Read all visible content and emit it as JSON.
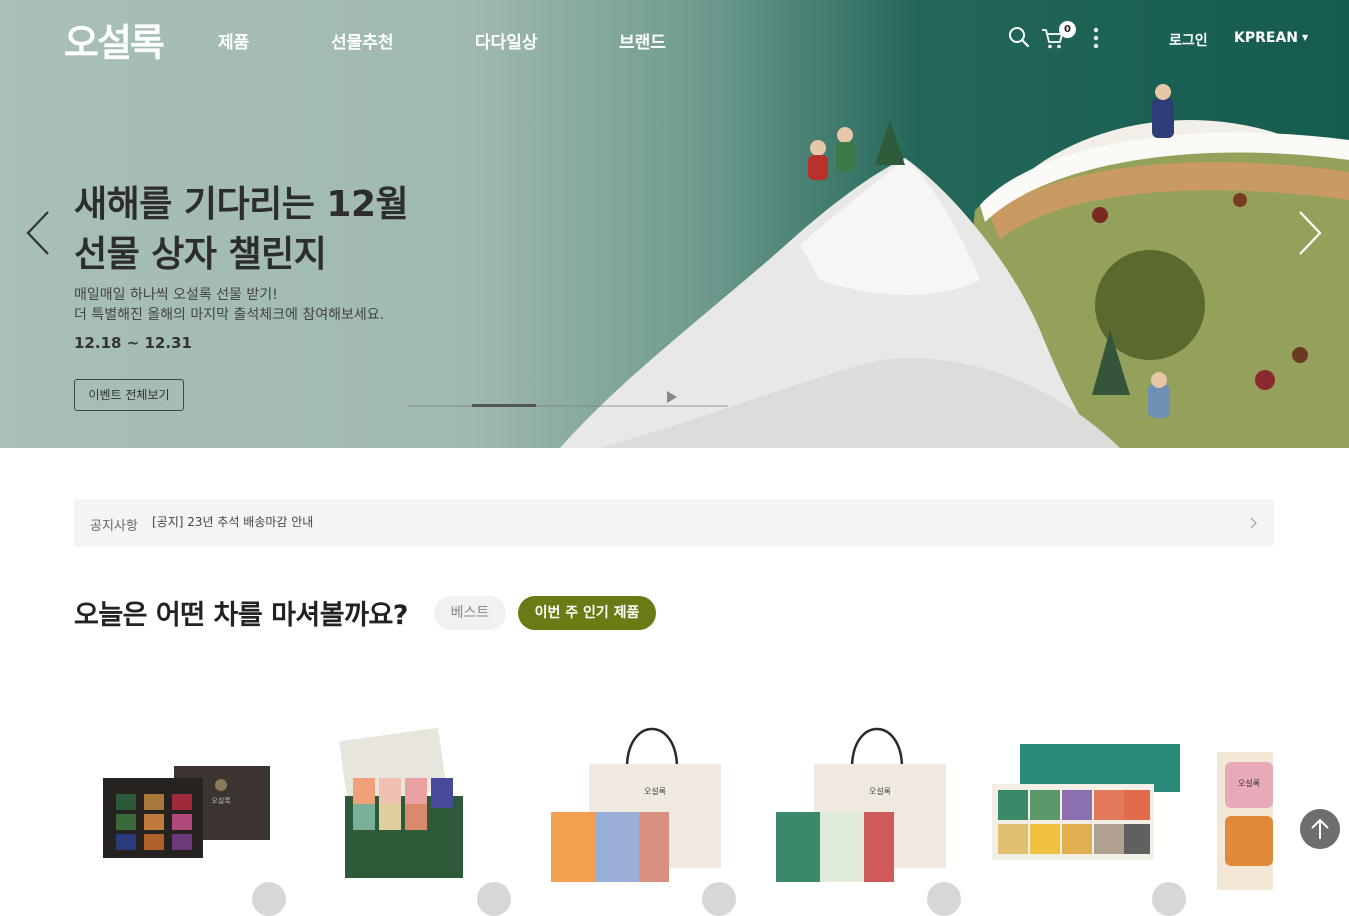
{
  "header": {
    "logo": "오설록",
    "nav": [
      "제품",
      "선물추천",
      "다다일상",
      "브랜드"
    ],
    "cart_count": "0",
    "login": "로그인",
    "language": "KPREAN"
  },
  "hero": {
    "title_line1": "새해를 기다리는 12월",
    "title_line2": "선물 상자 챌린지",
    "desc_line1": "매일매일 하나씩 오설록 선물 받기!",
    "desc_line2": "더 특별해진 올해의 마지막 출석체크에 참여해보세요.",
    "date": "12.18 ~ 12.31",
    "button": "이벤트 전체보기",
    "progress": 0.2
  },
  "notice": {
    "label": "공지사항",
    "text": "[공지] 23년 추석 배송마감 안내"
  },
  "section": {
    "title": "오늘은 어떤 차를 마셔볼까요?",
    "tabs": [
      {
        "label": "베스트",
        "active": false
      },
      {
        "label": "이번 주 인기 제품",
        "active": true
      }
    ]
  },
  "products": [
    {
      "icon": "dark-tea-gift-box-image",
      "box_label": "오설록"
    },
    {
      "icon": "green-tea-collection-box-image"
    },
    {
      "icon": "orange-tea-gift-bag-image",
      "bag_label": "오설록"
    },
    {
      "icon": "green-tea-gift-bag-image",
      "bag_label": "오설록"
    },
    {
      "icon": "teal-tea-assortment-box-image"
    },
    {
      "icon": "pink-tea-tin-box-image",
      "tin_label": "오설록"
    }
  ],
  "colors": {
    "accent": "#6b7a14",
    "hero_green": "#155b4f",
    "hero_sage": "#a9bfb8"
  }
}
